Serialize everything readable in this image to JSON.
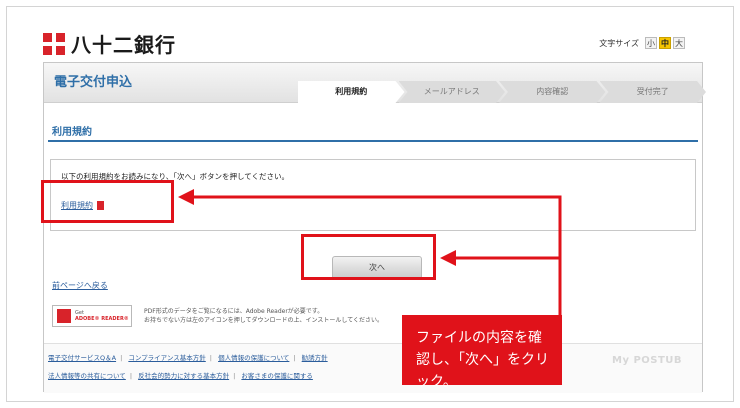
{
  "header": {
    "bank_name": "八十二銀行",
    "font_size_label": "文字サイズ",
    "font_size_options": [
      "小",
      "中",
      "大"
    ],
    "font_size_selected": "中"
  },
  "page": {
    "heading": "電子交付申込",
    "steps": [
      {
        "label": "利用規約",
        "active": true
      },
      {
        "label": "メールアドレス",
        "active": false
      },
      {
        "label": "内容確認",
        "active": false
      },
      {
        "label": "受付完了",
        "active": false
      }
    ],
    "section_heading": "利用規約",
    "instruction": "以下の利用規約をお読みになり、「次へ」ボタンを押してください。",
    "terms_link": "利用規約",
    "next_button": "次へ",
    "back_link": "前ページへ戻る"
  },
  "adobe": {
    "badge_line1": "Get",
    "badge_line2": "ADOBE® READER®",
    "note_line1": "PDF形式のデータをご覧になるには、Adobe Readerが必要です。",
    "note_line2": "お持ちでない方は左のアイコンを押してダウンロードの上、インストールしてください。"
  },
  "footer": {
    "row1": [
      "電子交付サービスQ＆A",
      "コンプライアンス基本方針",
      "個人情報の保護について",
      "勧誘方針"
    ],
    "row2": [
      "法人情報等の共有について",
      "反社会的勢力に対する基本方針",
      "お客さまの保護に関する"
    ]
  },
  "watermark": "My POSTUB",
  "annotation": {
    "callout_text": "ファイルの内容を確認し、「次へ」をクリック。",
    "color": "#e0121a"
  },
  "colors": {
    "accent": "#2f6fa8",
    "link": "#2b5d9c",
    "brand_red": "#d8232a"
  }
}
